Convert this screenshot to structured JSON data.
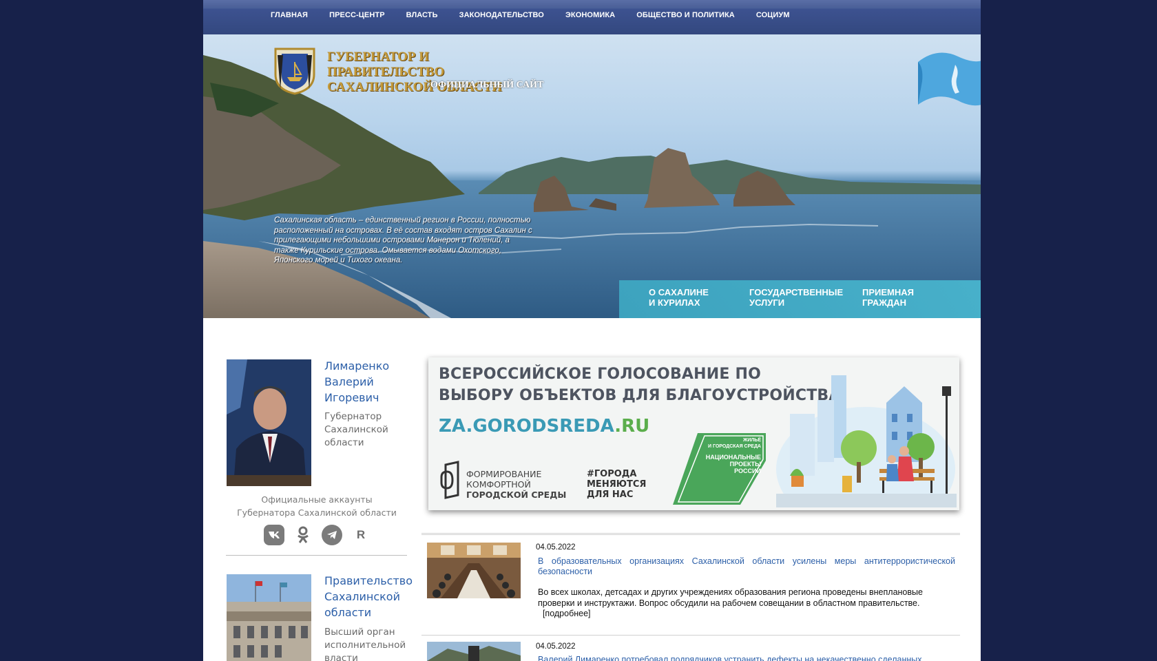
{
  "nav": {
    "items": [
      "ГЛАВНАЯ",
      "ПРЕСС-ЦЕНТР",
      "ВЛАСТЬ",
      "ЗАКОНОДАТЕЛЬСТВО",
      "ЭКОНОМИКА",
      "ОБЩЕСТВО И ПОЛИТИКА",
      "СОЦИУМ"
    ]
  },
  "header": {
    "title_lines": [
      "ГУБЕРНАТОР И",
      "ПРАВИТЕЛЬСТВО",
      "САХАЛИНСКОЙ ОБЛАСТИ"
    ],
    "official_site": "ОФИЦИАЛЬНЫЙ САЙТ",
    "description": "Сахалинская область – единственный регион в России, полностью расположенный на островах. В её состав входят остров Сахалин с прилегающими небольшими островами Монерон и Тюлений, а также Курильские острова. Омывается водами Охотского, Японского морей и Тихого океана.",
    "links": [
      {
        "line1": "О САХАЛИНЕ",
        "line2": "И КУРИЛАХ"
      },
      {
        "line1": "ГОСУДАРСТВЕННЫЕ",
        "line2": "УСЛУГИ"
      },
      {
        "line1": "ПРИЕМНАЯ",
        "line2": "ГРАЖДАН"
      }
    ]
  },
  "governor": {
    "name_lines": [
      "Лимаренко",
      "Валерий",
      "Игоревич"
    ],
    "role_lines": [
      "Губернатор",
      "Сахалинской",
      "области"
    ],
    "accounts_lines": [
      "Официальные аккаунты",
      "Губернатора Сахалинской области"
    ],
    "socials": [
      {
        "icon": "vk-icon",
        "glyph": "vk"
      },
      {
        "icon": "ok-icon",
        "glyph": "ok"
      },
      {
        "icon": "telegram-icon",
        "glyph": "➤"
      },
      {
        "icon": "rutube-icon",
        "glyph": "R"
      }
    ]
  },
  "government": {
    "name_lines": [
      "Правительство",
      "Сахалинской",
      "области"
    ],
    "desc_lines": [
      "Высший орган",
      "исполнительной",
      "власти"
    ]
  },
  "banner": {
    "title_lines": [
      "ВСЕРОССИЙСКОЕ ГОЛОСОВАНИЕ ПО",
      "ВЫБОРУ ОБЪЕКТОВ ДЛЯ БЛАГОУСТРОЙСТВА"
    ],
    "url_part1": "ZA.GORODSREDA",
    "url_part2": ".RU",
    "form_lines": [
      "ФОРМИРОВАНИЕ",
      "КОМФОРТНОЙ",
      "ГОРОДСКОЙ СРЕДЫ"
    ],
    "hashtag_lines": [
      "#ГОРОДА",
      "МЕНЯЮТСЯ",
      "ДЛЯ НАС"
    ],
    "badge_top": [
      "ЖИЛЬЁ",
      "И ГОРОДСКАЯ СРЕДА"
    ],
    "badge_main": [
      "НАЦИОНАЛЬНЫЕ",
      "ПРОЕКТЫ",
      "РОССИИ"
    ]
  },
  "news": [
    {
      "date": "04.05.2022",
      "title": "В образовательных организациях Сахалинской области усилены меры антитеррористической безопасности",
      "body": "Во всех школах, детсадах и других учреждениях образования региона проведены внеплановые проверки и инструктажи. Вопрос обсудили на рабочем совещании в областном правительстве.",
      "more": "[подробнее]"
    },
    {
      "date": "04.05.2022",
      "title": "Валерий Лимаренко потребовал подрядчиков устранить дефекты на некачественно сделанных"
    }
  ],
  "colors": {
    "background": "#17214a",
    "nav": "#33487f",
    "link": "#2c5fa8",
    "hero_links": "#3eaac4"
  }
}
